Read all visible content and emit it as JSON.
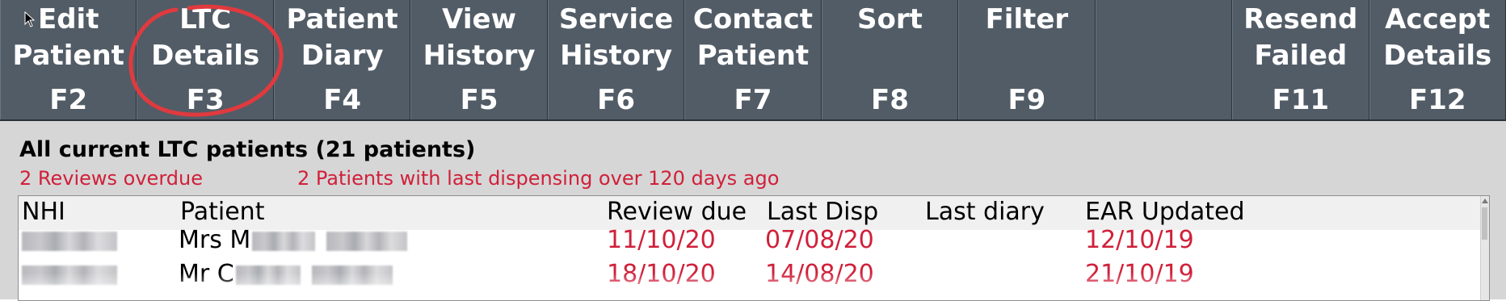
{
  "toolbar": {
    "buttons": [
      {
        "label": "Edit\nPatient",
        "key": "F2"
      },
      {
        "label": "LTC\nDetails",
        "key": "F3"
      },
      {
        "label": "Patient\nDiary",
        "key": "F4"
      },
      {
        "label": "View\nHistory",
        "key": "F5"
      },
      {
        "label": "Service\nHistory",
        "key": "F6"
      },
      {
        "label": "Contact\nPatient",
        "key": "F7"
      },
      {
        "label": "Sort",
        "key": "F8"
      },
      {
        "label": "Filter",
        "key": "F9"
      },
      {
        "label": "",
        "key": ""
      },
      {
        "label": "Resend\nFailed",
        "key": "F11"
      },
      {
        "label": "Accept\nDetails",
        "key": "F12"
      }
    ],
    "highlight_color": "#e03a3e"
  },
  "panel": {
    "title": "All current LTC patients (21 patients)",
    "alerts": [
      "2 Reviews overdue",
      "2 Patients with last dispensing over 120 days ago"
    ]
  },
  "table": {
    "columns": [
      "NHI",
      "Patient",
      "Review due",
      "Last Disp",
      "Last diary",
      "EAR Updated"
    ],
    "rows": [
      {
        "nhi": "",
        "patient": "Mrs M",
        "review_due": "11/10/20",
        "last_disp": "07/08/20",
        "last_diary": "",
        "ear_updated": "12/10/19"
      },
      {
        "nhi": "",
        "patient": "Mr C",
        "review_due": "18/10/20",
        "last_disp": "14/08/20",
        "last_diary": "",
        "ear_updated": "21/10/19"
      }
    ]
  },
  "colors": {
    "toolbar_bg": "#525c66",
    "alert_red": "#d0203a",
    "panel_bg": "#d6d6d6"
  }
}
